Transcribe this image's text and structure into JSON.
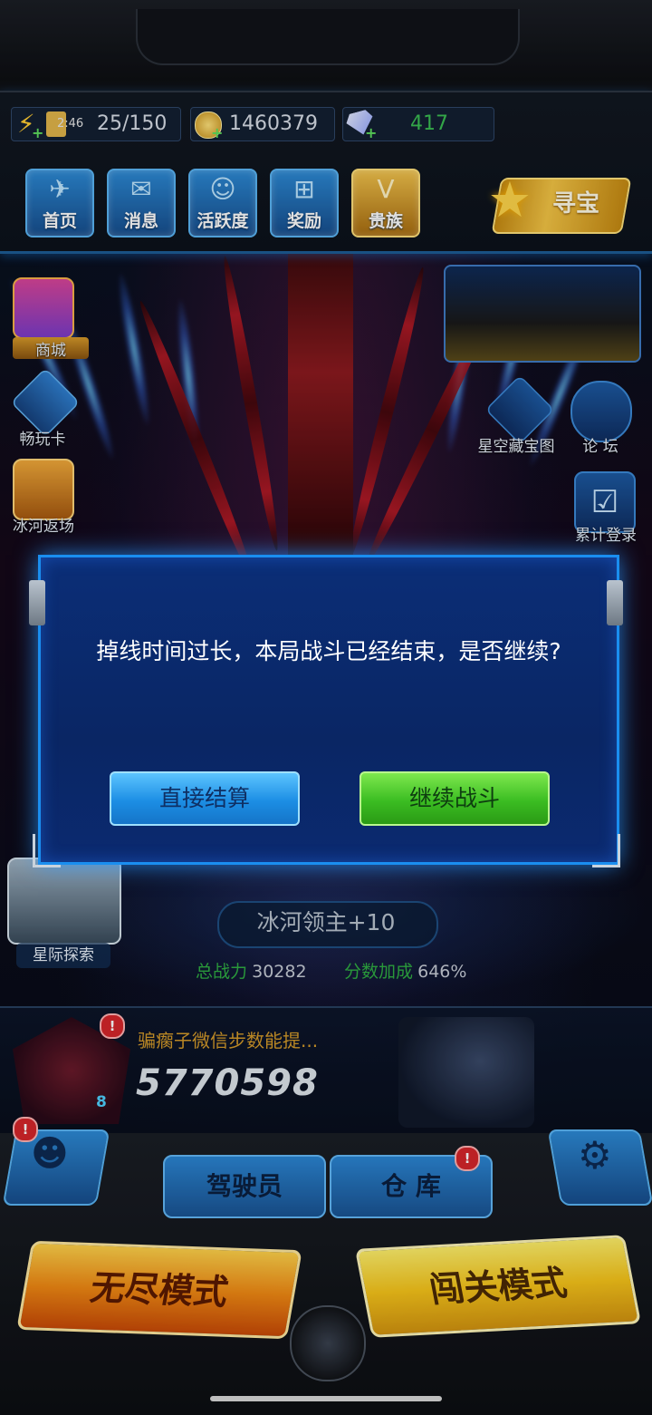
{
  "resources": {
    "energy_timer": "2:46",
    "energy": "25/150",
    "coins": "1460379",
    "diamonds": "417"
  },
  "nav": {
    "home": "首页",
    "messages": "消息",
    "activity": "活跃度",
    "rewards": "奖励",
    "vip": "贵族",
    "treasure": "寻宝"
  },
  "left_side": {
    "shop": "商城",
    "pass_card": "畅玩卡",
    "ice_return": "冰河返场"
  },
  "right_side": {
    "star_map": "星空藏宝图",
    "forum": "论  坛",
    "login_reward": "累计登录"
  },
  "dialog": {
    "message": "掉线时间过长，本局战斗已经结束，是否继续?",
    "settle_button": "直接结算",
    "continue_button": "继续战斗"
  },
  "ship": {
    "name": "冰河领主+10",
    "power_label": "总战力",
    "power_value": "30282",
    "bonus_label": "分数加成",
    "bonus_value": "646%"
  },
  "explore": {
    "label": "星际探索"
  },
  "player": {
    "name": "骗瘸子微信步数能提...",
    "score": "5770598",
    "level": "8",
    "notification": "!"
  },
  "bottom": {
    "pilot": "驾驶员",
    "warehouse": "仓 库",
    "endless_mode": "无尽模式",
    "stage_mode": "闯关模式",
    "friends_badge": "!",
    "warehouse_badge": "!"
  },
  "colors": {
    "accent_blue": "#1a8ef0",
    "settle_blue": "#1c8ee4",
    "continue_green": "#3bbd22",
    "power_green": "#2fae43",
    "badge_red": "#d7262b"
  }
}
